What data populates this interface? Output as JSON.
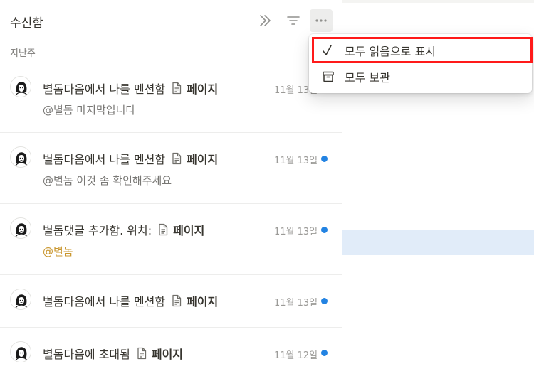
{
  "inbox": {
    "title": "수신함",
    "section_label": "지난주",
    "notifications": [
      {
        "actor": "별돔",
        "action": " 다음에서 나를 멘션함",
        "page": "페이지",
        "date": "11월 13일",
        "subtext": "@별돔 마지막입니다",
        "subtext_style": "gray",
        "unread": true
      },
      {
        "actor": "별돔",
        "action": " 다음에서 나를 멘션함",
        "page": "페이지",
        "date": "11월 13일",
        "subtext": "@별돔 이것 좀 확인해주세요",
        "subtext_style": "gray",
        "unread": true
      },
      {
        "actor": "별돔",
        "action": " 댓글 추가함. 위치:",
        "page": "페이지",
        "date": "11월 13일",
        "subtext": "@별돔",
        "subtext_style": "gold",
        "unread": true
      },
      {
        "actor": "별돔",
        "action": " 다음에서 나를 멘션함",
        "page": "페이지",
        "date": "11월 13일",
        "subtext": "",
        "subtext_style": "gray",
        "unread": true
      },
      {
        "actor": "별돔",
        "action": " 다음에 초대됨",
        "page": "페이지",
        "date": "11월 12일",
        "subtext": "",
        "subtext_style": "gray",
        "unread": true
      }
    ]
  },
  "menu": {
    "mark_all_read": "모두 읽음으로 표시",
    "archive_all": "모두 보관"
  },
  "icons": {
    "collapse": "double-chevron-right-icon",
    "filter": "filter-icon",
    "more": "more-horizontal-icon",
    "check": "checkmark-icon",
    "archive": "archive-icon",
    "page": "page-document-icon"
  },
  "colors": {
    "unread_dot": "#2383e2",
    "mention_gold": "#c9962e",
    "highlight_box": "#ff1a1a",
    "selected_row": "#e1ecf9"
  }
}
